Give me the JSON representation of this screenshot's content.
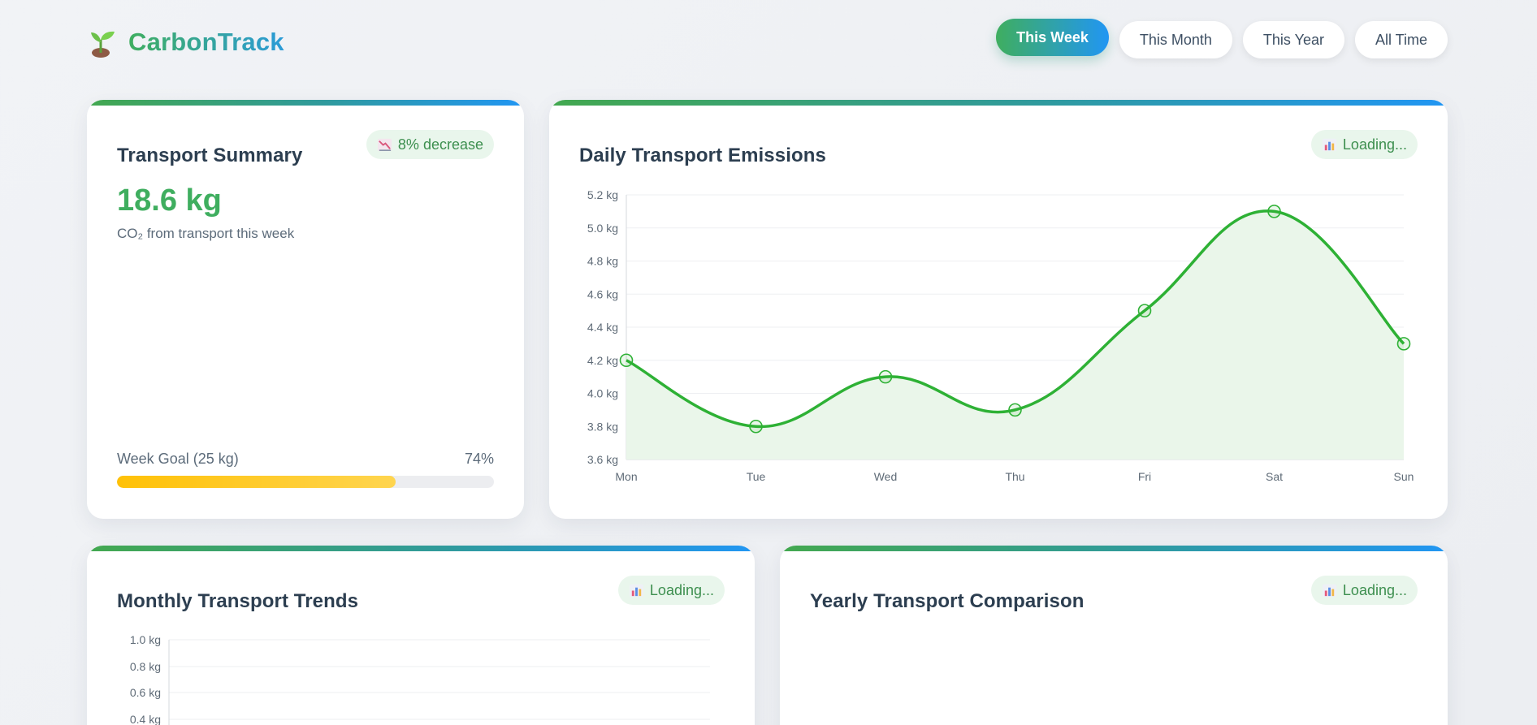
{
  "app": {
    "name": "CarbonTrack",
    "logo_icon": "seedling-icon",
    "brand_gradient": [
      "#3fae5f",
      "#2196f3"
    ]
  },
  "filters": [
    {
      "label": "This Week",
      "active": true
    },
    {
      "label": "This Month",
      "active": false
    },
    {
      "label": "This Year",
      "active": false
    },
    {
      "label": "All Time",
      "active": false
    }
  ],
  "summary": {
    "title": "Transport Summary",
    "badge_icon": "chart-decreasing-icon",
    "badge_text": "8% decrease",
    "value": "18.6 kg",
    "subtitle": "CO₂ from transport this week",
    "goal_label": "Week Goal (25 kg)",
    "goal_percent_text": "74%",
    "goal_fraction": 0.74,
    "goal_color": "#ffc107"
  },
  "daily": {
    "title": "Daily Transport Emissions",
    "badge_icon": "bar-chart-icon",
    "badge_text": "Loading..."
  },
  "monthly": {
    "title": "Monthly Transport Trends",
    "badge_icon": "bar-chart-icon",
    "badge_text": "Loading..."
  },
  "yearly": {
    "title": "Yearly Transport Comparison",
    "badge_icon": "bar-chart-icon",
    "badge_text": "Loading..."
  },
  "chart_data": [
    {
      "type": "area",
      "categories": [
        "Mon",
        "Tue",
        "Wed",
        "Thu",
        "Fri",
        "Sat",
        "Sun"
      ],
      "values": [
        4.2,
        3.8,
        4.1,
        3.9,
        4.5,
        5.1,
        4.3
      ],
      "ylim": [
        3.6,
        5.2
      ],
      "yticks": [
        "3.6 kg",
        "3.8 kg",
        "4.0 kg",
        "4.2 kg",
        "4.4 kg",
        "4.6 kg",
        "4.8 kg",
        "5.0 kg",
        "5.2 kg"
      ],
      "line_color": "#2eb135",
      "fill_color": "#eaf6ea",
      "grid": true
    },
    {
      "type": "line",
      "categories": [],
      "values": [],
      "ylim": [
        0,
        1.0
      ],
      "yticks": [
        "0.4 kg",
        "0.6 kg",
        "0.8 kg",
        "1.0 kg"
      ],
      "grid": true
    }
  ]
}
